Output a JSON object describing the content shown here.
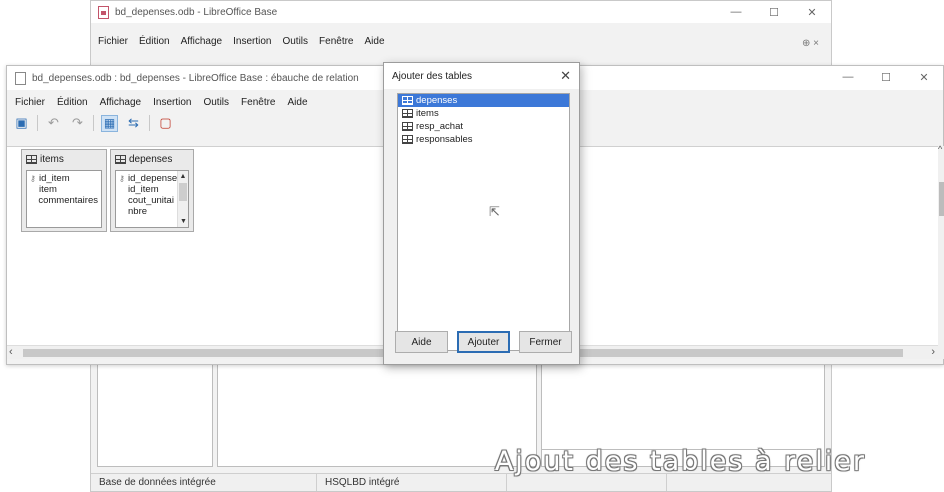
{
  "main_window": {
    "title": "bd_depenses.odb - LibreOffice Base",
    "menu": [
      "Fichier",
      "Édition",
      "Affichage",
      "Insertion",
      "Outils",
      "Fenêtre",
      "Aide"
    ],
    "status": [
      "Base de données intégrée",
      "HSQLBD intégré"
    ]
  },
  "relation_window": {
    "title": "bd_depenses.odb : bd_depenses - LibreOffice Base : ébauche de relation",
    "menu": [
      "Fichier",
      "Édition",
      "Affichage",
      "Insertion",
      "Outils",
      "Fenêtre",
      "Aide"
    ],
    "tables": [
      {
        "name": "items",
        "fields": [
          {
            "label": "id_item",
            "key": true
          },
          {
            "label": "item",
            "key": false
          },
          {
            "label": "commentaires",
            "key": false
          }
        ]
      },
      {
        "name": "depenses",
        "fields": [
          {
            "label": "id_depense",
            "key": true
          },
          {
            "label": "id_item",
            "key": false
          },
          {
            "label": "cout_unitai",
            "key": false
          },
          {
            "label": "nbre",
            "key": false
          }
        ]
      }
    ]
  },
  "dialog": {
    "title": "Ajouter des tables",
    "tables": [
      "depenses",
      "items",
      "resp_achat",
      "responsables"
    ],
    "selected": "depenses",
    "buttons": {
      "help": "Aide",
      "add": "Ajouter",
      "close": "Fermer"
    }
  },
  "caption": "Ajout des tables à relier",
  "icons": {
    "window_controls": [
      "minimize-icon",
      "maximize-icon",
      "close-icon"
    ],
    "table_icon": "table-grid-icon",
    "save_icon": "save-icon",
    "undo_icon": "undo-icon",
    "redo_icon": "redo-icon",
    "add_table_icon": "add-table-icon",
    "new_relation_icon": "new-relation-icon",
    "new_doc_icon": "new-document-icon"
  },
  "colors": {
    "selection": "#3c78d8",
    "accent": "#2b6cb3"
  }
}
